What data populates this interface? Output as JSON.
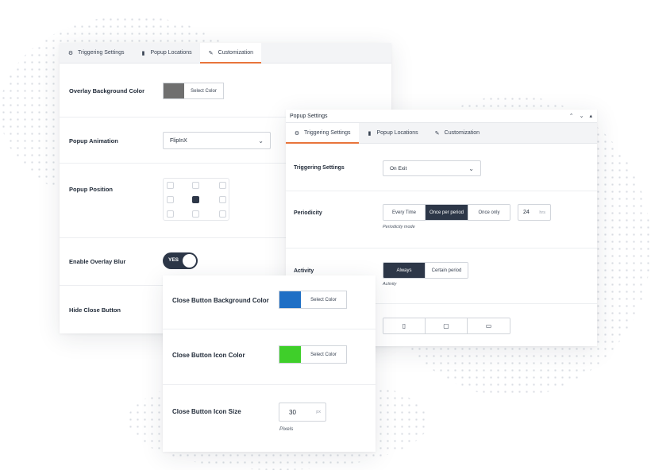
{
  "customization_panel": {
    "tabs": [
      {
        "label": "Triggering Settings",
        "icon": "gear-icon"
      },
      {
        "label": "Popup Locations",
        "icon": "document-icon"
      },
      {
        "label": "Customization",
        "icon": "brush-icon",
        "active": true
      }
    ],
    "overlay_bg_color": {
      "label": "Overlay Background Color",
      "button": "Select Color",
      "color": "#6f6f6f"
    },
    "popup_animation": {
      "label": "Popup Animation",
      "value": "FlipInX"
    },
    "popup_position": {
      "label": "Popup Position",
      "selected_cell": "middle-center"
    },
    "overlay_blur": {
      "label": "Enable Overlay Blur",
      "toggle_text": "YES",
      "on": true
    },
    "hide_close": {
      "label": "Hide Close Button"
    }
  },
  "popup_settings_panel": {
    "title": "Popup Settings",
    "tabs": [
      {
        "label": "Triggering Settings",
        "icon": "gear-icon",
        "active": true
      },
      {
        "label": "Popup Locations",
        "icon": "document-icon"
      },
      {
        "label": "Customization",
        "icon": "brush-icon"
      }
    ],
    "triggering": {
      "label": "Triggering Settings",
      "value": "On Exit"
    },
    "periodicity": {
      "label": "Periodicity",
      "options": [
        "Every Time",
        "Once per period",
        "Once only"
      ],
      "selected": "Once per period",
      "period_value": "24",
      "period_unit": "hrs",
      "help": "Periodicity mode"
    },
    "activity": {
      "label": "Activity",
      "options": [
        "Always",
        "Certain period"
      ],
      "selected": "Always",
      "help": "Activity"
    },
    "devices": {
      "icons": [
        "mobile-icon",
        "tablet-icon",
        "desktop-icon"
      ]
    }
  },
  "close_button_panel": {
    "bg_color": {
      "label": "Close Button Background Color",
      "button": "Select Color",
      "color": "#1f6fc5"
    },
    "icon_color": {
      "label": "Close Button Icon Color",
      "button": "Select Color",
      "color": "#3fcf2a"
    },
    "icon_size": {
      "label": "Close Button Icon Size",
      "value": "30",
      "unit": "px",
      "help": "Pixels"
    }
  },
  "accent_color": "#e8743b",
  "dark_color": "#2d3748"
}
